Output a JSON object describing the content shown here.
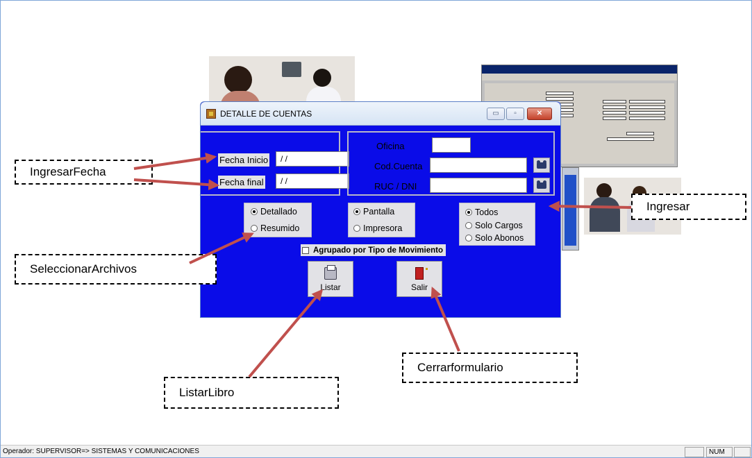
{
  "dialog": {
    "title": "DETALLE DE CUENTAS",
    "window_buttons": {
      "minimize": "▭",
      "maximize": "▫",
      "close": "✕"
    }
  },
  "fechas": {
    "inicio_label": "Fecha Inicio",
    "inicio_value": "/ /",
    "final_label": "Fecha final",
    "final_value": "/ /"
  },
  "cuenta": {
    "oficina_label": "Oficina",
    "oficina_value": "",
    "cod_cuenta_label": "Cod.Cuenta",
    "cod_cuenta_value": "",
    "ruc_label": "RUC / DNI",
    "ruc_value": ""
  },
  "tipo_reporte": {
    "options": [
      "Detallado",
      "Resumido"
    ],
    "selected": "Detallado"
  },
  "salida": {
    "options": [
      "Pantalla",
      "Impresora"
    ],
    "selected": "Pantalla"
  },
  "movimientos": {
    "options": [
      "Todos",
      "Solo Cargos",
      "Solo Abonos"
    ],
    "selected": "Todos"
  },
  "agrupado_label": "Agrupado por Tipo de Movimiento",
  "buttons": {
    "listar": "Listar",
    "salir": "Salir"
  },
  "annotations": {
    "ingresar_fecha": "IngresarFecha",
    "ingresar": "Ingresar",
    "seleccionar_archivos": "SeleccionarArchivos",
    "listar_libro": "ListarLibro",
    "cerrar_formulario": "Cerrarformulario"
  },
  "status_bar": {
    "operator": "Operador: SUPERVISOR=> SISTEMAS Y COMUNICACIONES",
    "num": "NUM"
  },
  "colors": {
    "dialog_background": "#0a0ce8",
    "arrow": "#c0504d",
    "panel": "#e2e2e6"
  }
}
